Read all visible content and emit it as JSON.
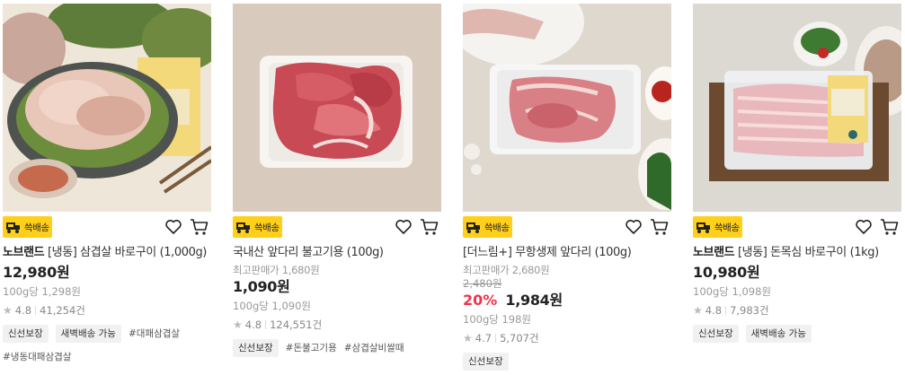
{
  "products": [
    {
      "badge": "쓱배송",
      "brand": "노브랜드",
      "name": " [냉동] 삼겹살 바로구이 (1,000g)",
      "orig_label": "",
      "strike_price": "",
      "discount": "",
      "price": "12,980원",
      "unit_price": "100g당 1,298원",
      "rating": "4.8",
      "reviews": "41,254건",
      "chips": [
        "신선보장",
        "새벽배송 가능"
      ],
      "hashtags": [
        "#대패삼겹살",
        "#냉동대패삼겹살"
      ]
    },
    {
      "badge": "쓱배송",
      "brand": "",
      "name": "국내산 앞다리 불고기용 (100g)",
      "orig_label": "최고판매가 1,680원",
      "strike_price": "",
      "discount": "",
      "price": "1,090원",
      "unit_price": "100g당 1,090원",
      "rating": "4.8",
      "reviews": "124,551건",
      "chips": [
        "신선보장"
      ],
      "hashtags": [
        "#돈불고기용",
        "#삼겹살비쌀때"
      ]
    },
    {
      "badge": "쓱배송",
      "brand": "",
      "name": "[더느림+] 무항생제 앞다리 (100g)",
      "orig_label": "최고판매가 2,680원",
      "strike_price": "2,480원",
      "discount": "20%",
      "price": "1,984원",
      "unit_price": "100g당 198원",
      "rating": "4.7",
      "reviews": "5,707건",
      "chips": [
        "신선보장"
      ],
      "hashtags": []
    },
    {
      "badge": "쓱배송",
      "brand": "노브랜드",
      "name": " [냉동] 돈목심 바로구이 (1kg)",
      "orig_label": "",
      "strike_price": "",
      "discount": "",
      "price": "10,980원",
      "unit_price": "100g당 1,098원",
      "rating": "4.8",
      "reviews": "7,983건",
      "chips": [
        "신선보장",
        "새벽배송 가능"
      ],
      "hashtags": []
    }
  ],
  "colors": {
    "badge_bg": "#ffd01b",
    "discount": "#f2334b",
    "chip_bg": "#f1f1f1"
  },
  "icons": [
    "delivery-truck-icon",
    "heart-icon",
    "cart-icon",
    "star-icon"
  ]
}
